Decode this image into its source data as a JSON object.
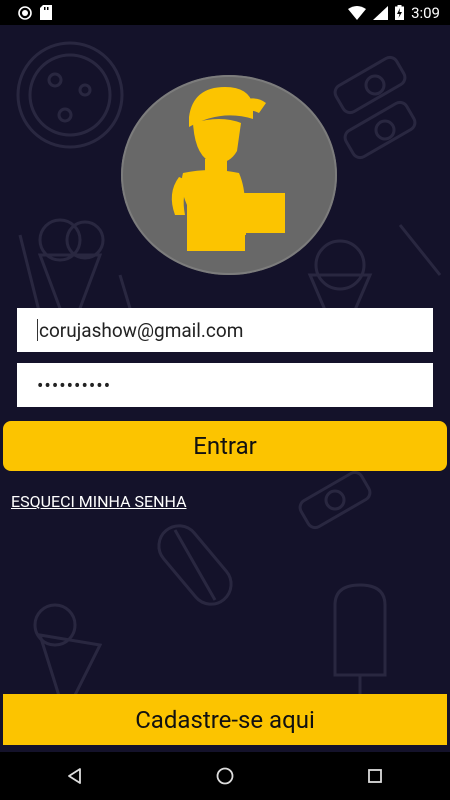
{
  "status_bar": {
    "time": "3:09",
    "icons": [
      "circle-notification-icon",
      "sd-card-icon",
      "wifi-icon",
      "signal-icon",
      "battery-charging-icon"
    ]
  },
  "login": {
    "email_value": "corujashow@gmail.com",
    "password_value": "••••••••••",
    "login_button": "Entrar",
    "forgot_password": "ESQUECI MINHA SENHA",
    "register_button": "Cadastre-se aqui"
  },
  "colors": {
    "background": "#14122a",
    "accent": "#fcc400",
    "avatar_circle": "#686868"
  },
  "nav_bar": {
    "icons": [
      "back-icon",
      "home-icon",
      "recents-icon"
    ]
  }
}
